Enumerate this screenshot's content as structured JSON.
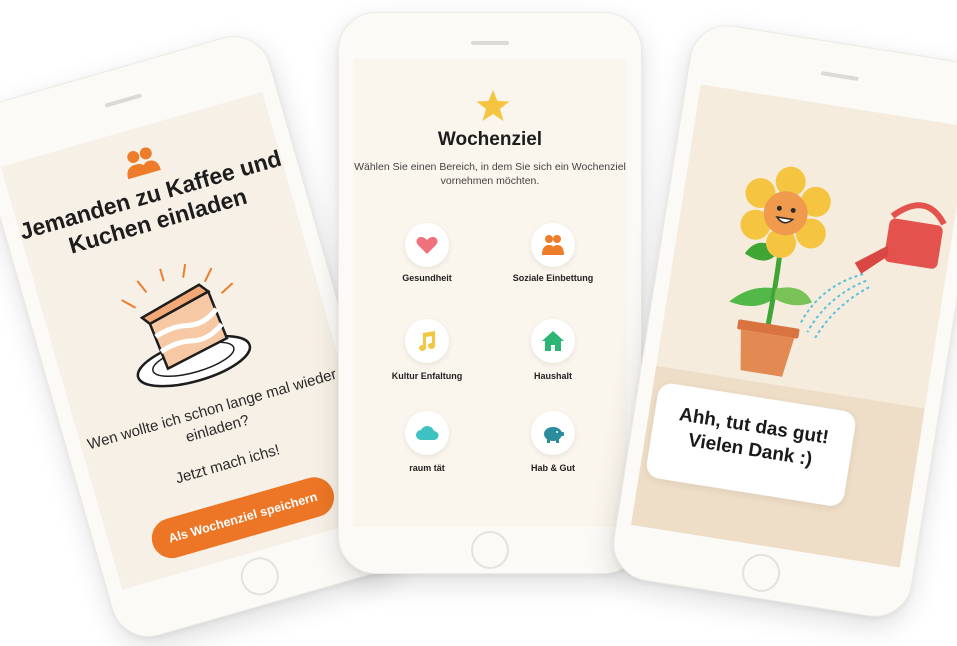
{
  "screen1": {
    "title": "Jemanden zu Kaffee und Kuchen einladen",
    "question": "Wen wollte ich schon lange mal wieder einladen?",
    "subtext": "Jetzt mach ichs!",
    "cta_label": "Als Wochenziel speichern",
    "icon": "people-icon",
    "illustration": "cake-icon"
  },
  "screen2": {
    "title": "Wochenziel",
    "description": "Wählen Sie einen Bereich, in dem Sie sich ein Wochenziel vornehmen möchten.",
    "icon": "star-icon",
    "categories": [
      {
        "label": "Gesundheit",
        "icon": "heart-icon",
        "color": "#f1707d"
      },
      {
        "label": "Soziale Einbettung",
        "icon": "people-icon",
        "color": "#ee7d2b"
      },
      {
        "label": "Kultur Enfaltung",
        "icon": "music-note-icon",
        "color": "#f3c742"
      },
      {
        "label": "Haushalt",
        "icon": "house-icon",
        "color": "#2bb673"
      },
      {
        "label": "raum tät",
        "icon": "cloud-icon",
        "color": "#3ec1c1"
      },
      {
        "label": "Hab & Gut",
        "icon": "piggy-bank-icon",
        "color": "#2b8c9c"
      }
    ]
  },
  "screen3": {
    "message": "Ahh, tut das gut! Vielen Dank :)",
    "illustration": "flower-watering-can-icon"
  },
  "colors": {
    "accent": "#ec7625",
    "screen_bg": "#f6f0e6",
    "flower": "#f5c542",
    "pot": "#e38a52",
    "watering_can": "#e4524e"
  }
}
